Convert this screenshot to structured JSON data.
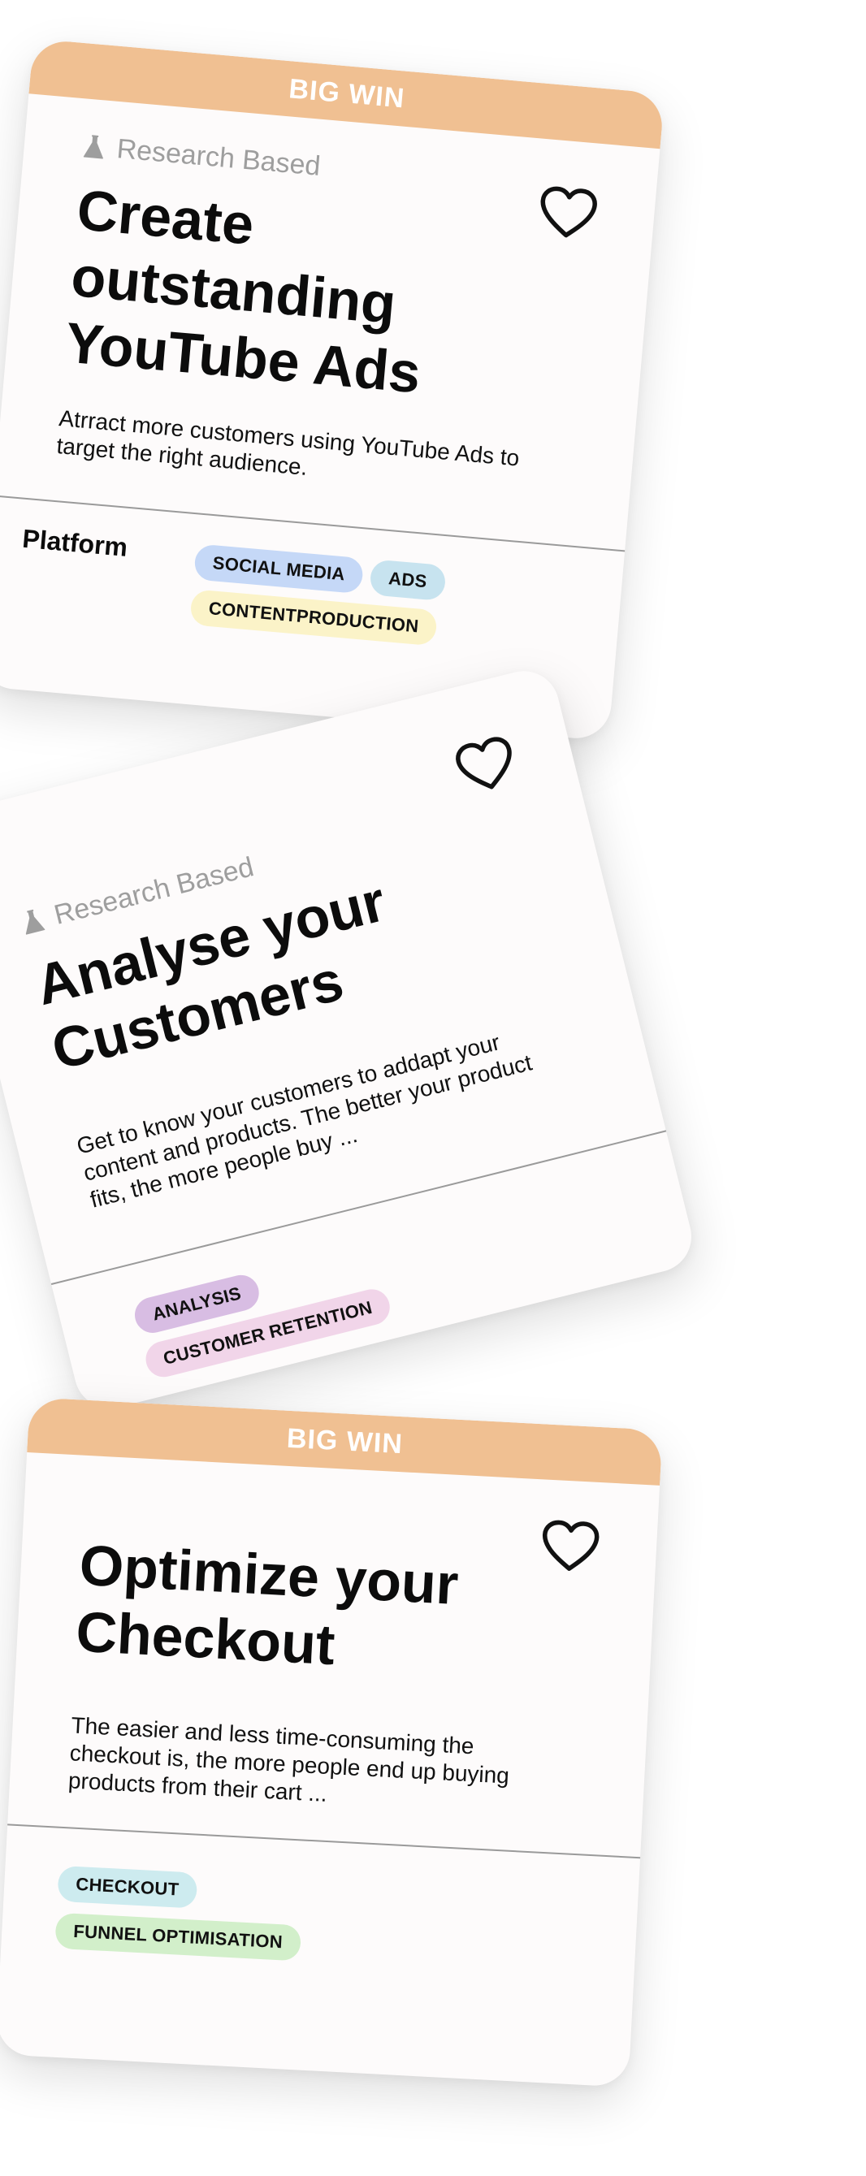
{
  "colors": {
    "banner": "#f0c092",
    "card_bg": "#fdfbfb",
    "muted_text": "#9e9e9e",
    "title_text": "#0c0c0c"
  },
  "cards": [
    {
      "banner": "BIG WIN",
      "research_label": "Research Based",
      "title": "Create outstanding YouTube Ads",
      "description": "Atrract more customers using YouTube Ads to target the right audience.",
      "footer_label": "Platform",
      "tags": [
        {
          "label": "SOCIAL MEDIA",
          "color": "#c5d8f7"
        },
        {
          "label": "ADS",
          "color": "#c7e3ef"
        },
        {
          "label": "CONTENTPRODUCTION",
          "color": "#fbf3c8"
        }
      ]
    },
    {
      "research_label": "Research Based",
      "title": "Analyse your Customers",
      "description": "Get to know your customers to addapt your content and products. The better your product fits, the more people buy ...",
      "tags": [
        {
          "label": "ANALYSIS",
          "color": "#d8bde3"
        },
        {
          "label": "CUSTOMER RETENTION",
          "color": "#f1d5e9"
        }
      ]
    },
    {
      "banner": "BIG WIN",
      "title": "Optimize your Checkout",
      "description": "The easier and less time-consuming the checkout is, the more people end up buying products from their cart ...",
      "tags": [
        {
          "label": "CHECKOUT",
          "color": "#cdebef"
        },
        {
          "label": "FUNNEL OPTIMISATION",
          "color": "#d2efca"
        }
      ]
    }
  ]
}
